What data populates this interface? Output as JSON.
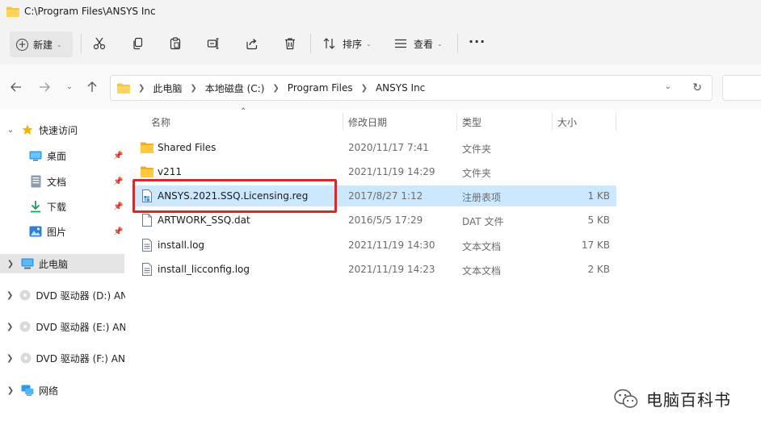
{
  "window": {
    "title": "C:\\Program Files\\ANSYS Inc"
  },
  "toolbar": {
    "new_label": "新建",
    "sort_label": "排序",
    "view_label": "查看",
    "more_label": "···"
  },
  "address": {
    "crumbs": [
      "此电脑",
      "本地磁盘 (C:)",
      "Program Files",
      "ANSYS Inc"
    ]
  },
  "sidebar": {
    "quick_access": "快速访问",
    "items": [
      {
        "label": "桌面",
        "icon": "desktop-icon"
      },
      {
        "label": "文档",
        "icon": "document-icon"
      },
      {
        "label": "下载",
        "icon": "download-icon"
      },
      {
        "label": "图片",
        "icon": "pictures-icon"
      }
    ],
    "this_pc": "此电脑",
    "drives": [
      {
        "label": "DVD 驱动器 (D:) AN"
      },
      {
        "label": "DVD 驱动器 (E:) AN"
      },
      {
        "label": "DVD 驱动器 (F:) AN"
      }
    ],
    "network": "网络"
  },
  "columns": {
    "name": "名称",
    "date": "修改日期",
    "type": "类型",
    "size": "大小"
  },
  "files": [
    {
      "name": "Shared Files",
      "date": "2020/11/17 7:41",
      "type": "文件夹",
      "size": "",
      "icon": "folder-icon"
    },
    {
      "name": "v211",
      "date": "2021/11/19 14:29",
      "type": "文件夹",
      "size": "",
      "icon": "folder-icon"
    },
    {
      "name": "ANSYS.2021.SSQ.Licensing.reg",
      "date": "2017/8/27 1:12",
      "type": "注册表项",
      "size": "1 KB",
      "icon": "registry-file-icon",
      "selected": true
    },
    {
      "name": "ARTWORK_SSQ.dat",
      "date": "2016/5/5 17:29",
      "type": "DAT 文件",
      "size": "5 KB",
      "icon": "file-icon"
    },
    {
      "name": "install.log",
      "date": "2021/11/19 14:30",
      "type": "文本文档",
      "size": "17 KB",
      "icon": "text-file-icon"
    },
    {
      "name": "install_licconfig.log",
      "date": "2021/11/19 14:23",
      "type": "文本文档",
      "size": "2 KB",
      "icon": "text-file-icon"
    }
  ],
  "watermark": {
    "text": "电脑百科书"
  },
  "colors": {
    "selection": "#cce8ff",
    "highlight_border": "#d12b2b",
    "folder": "#f5c242"
  }
}
